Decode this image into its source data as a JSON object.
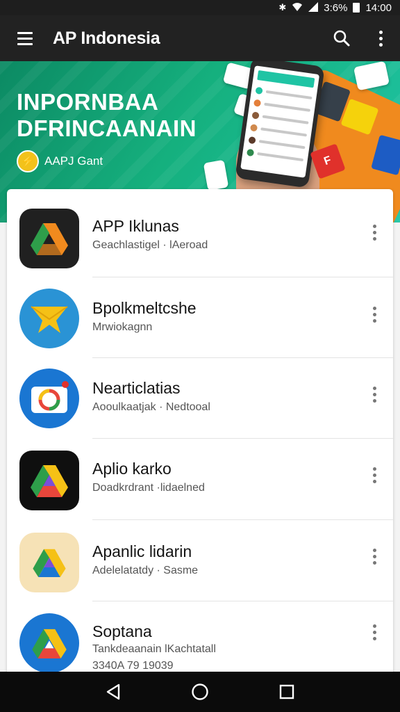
{
  "status_bar": {
    "battery": "3:6%",
    "time": "14:00"
  },
  "app_bar": {
    "title": "AP Indonesia"
  },
  "banner": {
    "headline_line1": "INPORNBAA",
    "headline_line2": "DFRINCAANAIN",
    "badge_text": "AAPJ Gant",
    "phone_card_text": "F"
  },
  "apps": [
    {
      "title": "APP Iklunas",
      "subtitle": "Geachlastigel · lAeroad",
      "subtitle2": ""
    },
    {
      "title": "Bpolkmeltcshe",
      "subtitle": "Mrwiokagnn",
      "subtitle2": ""
    },
    {
      "title": "Nearticlatias",
      "subtitle": "Aooulkaatjak · Nedtooal",
      "subtitle2": ""
    },
    {
      "title": "Aplio karko",
      "subtitle": "Doadkrdrant ·lidaelned",
      "subtitle2": ""
    },
    {
      "title": "Apanlic lidarin",
      "subtitle": "Adelelatatdy · Sasme",
      "subtitle2": ""
    },
    {
      "title": "Soptana",
      "subtitle": "Tankdeaanain lKachtatall",
      "subtitle2": "3340A 79 19039"
    }
  ],
  "colors": {
    "app_bar": "#222222",
    "banner_green": "#15b07e",
    "accent_orange": "#f08a1e"
  }
}
